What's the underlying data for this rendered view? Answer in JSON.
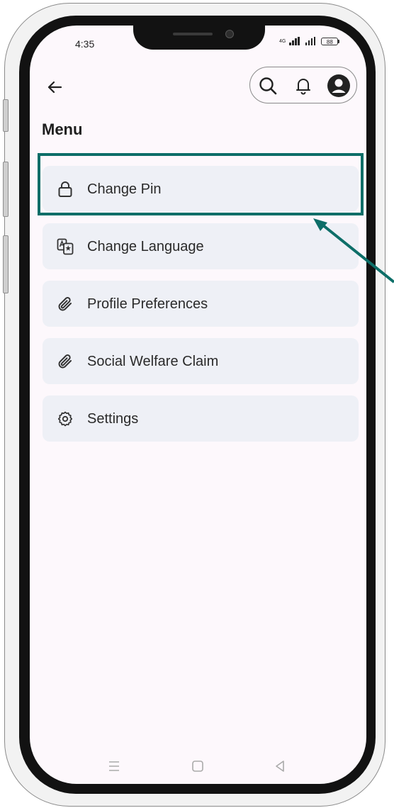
{
  "status_bar": {
    "time": "4:35",
    "network": "4G",
    "battery": "88"
  },
  "header": {
    "back_icon": "arrow-left-icon",
    "action_icons": [
      "search-icon",
      "bell-icon",
      "user-avatar-icon"
    ]
  },
  "page": {
    "title": "Menu"
  },
  "menu": {
    "items": [
      {
        "label": "Change Pin",
        "icon": "lock-icon"
      },
      {
        "label": "Change Language",
        "icon": "translate-icon"
      },
      {
        "label": "Profile Preferences",
        "icon": "paperclip-icon"
      },
      {
        "label": "Social Welfare Claim",
        "icon": "paperclip-icon"
      },
      {
        "label": "Settings",
        "icon": "gear-icon"
      }
    ]
  },
  "annotation": {
    "highlighted_item": "Change Pin",
    "color": "#0d6e68"
  },
  "nav_bar": {
    "buttons": [
      "menu-icon",
      "home-icon",
      "back-icon"
    ]
  },
  "colors": {
    "screen_bg": "#fdf8fc",
    "item_bg": "#eef0f6",
    "accent": "#0d6e68"
  }
}
